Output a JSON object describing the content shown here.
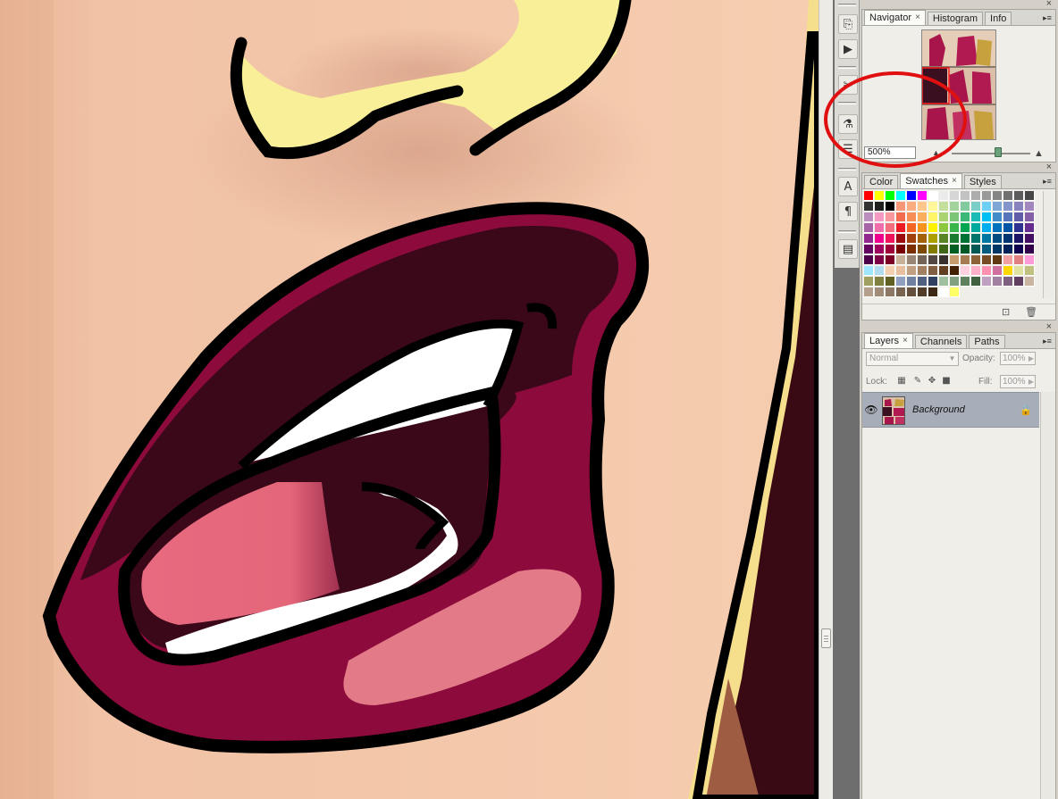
{
  "navigator": {
    "tabs": [
      {
        "label": "Navigator",
        "close": "×",
        "active": true
      },
      {
        "label": "Histogram",
        "active": false
      },
      {
        "label": "Info",
        "active": false
      }
    ],
    "zoom_value": "500%",
    "close": "×",
    "menu": "▸≡"
  },
  "swatches": {
    "tabs": [
      {
        "label": "Color",
        "active": false
      },
      {
        "label": "Swatches",
        "close": "×",
        "active": true
      },
      {
        "label": "Styles",
        "active": false
      }
    ],
    "close": "×",
    "menu": "▸≡",
    "colors": [
      "#ff0000",
      "#ffff00",
      "#00ff00",
      "#00ffff",
      "#0000ff",
      "#ff00ff",
      "#ffffff",
      "#ebebeb",
      "#d6d6d6",
      "#c2c2c2",
      "#adadad",
      "#999999",
      "#858585",
      "#707070",
      "#5c5c5c",
      "#474747",
      "#333333",
      "#1f1f1f",
      "#000000",
      "#f7977a",
      "#fbad82",
      "#fdc68a",
      "#fff79a",
      "#c4df9b",
      "#a2d39c",
      "#82ca9d",
      "#7bcdc8",
      "#6ecff6",
      "#7ea7d8",
      "#8493ca",
      "#8882be",
      "#a187be",
      "#bc8dbf",
      "#f49ac2",
      "#f6989d",
      "#f26c4f",
      "#f68e55",
      "#fbaf5c",
      "#fff467",
      "#acd372",
      "#7cc576",
      "#3bb878",
      "#1abbb4",
      "#00bff3",
      "#438cca",
      "#5574b9",
      "#605ca8",
      "#855fa8",
      "#a763a8",
      "#f06ea9",
      "#f26d7d",
      "#ed1c24",
      "#f26522",
      "#f7941d",
      "#fff200",
      "#8dc73f",
      "#39b54a",
      "#00a651",
      "#00a99d",
      "#00aeef",
      "#0072bc",
      "#0054a6",
      "#2e3192",
      "#662d91",
      "#92278f",
      "#ec008c",
      "#ed145b",
      "#9e0b0f",
      "#a0410d",
      "#a36209",
      "#aba000",
      "#598527",
      "#1a7b30",
      "#007236",
      "#00746b",
      "#0076a3",
      "#004b80",
      "#003471",
      "#1b1464",
      "#440e62",
      "#630460",
      "#9e005d",
      "#9e0039",
      "#790000",
      "#7b2e00",
      "#7d4900",
      "#827b00",
      "#406618",
      "#005e20",
      "#005826",
      "#005952",
      "#005b7f",
      "#003663",
      "#002157",
      "#0d004c",
      "#32004b",
      "#4b0049",
      "#7b0046",
      "#7a0026",
      "#c7b299",
      "#998675",
      "#736357",
      "#534741",
      "#37302d",
      "#c69c6d",
      "#a67c52",
      "#8c6239",
      "#754c24",
      "#603913",
      "#f0a0a0",
      "#e08080",
      "#ff9ad8",
      "#9fe6ff",
      "#b0dcf0",
      "#f5d0b0",
      "#e8c0a0",
      "#c0a080",
      "#a08060",
      "#806040",
      "#604020",
      "#402000",
      "#ffd0e0",
      "#ffb0c8",
      "#ff90b0",
      "#d070a0",
      "#ffd700",
      "#e0e0a0",
      "#c0c080",
      "#a0a060",
      "#808040",
      "#606020",
      "#8fa0c0",
      "#7080a0",
      "#506080",
      "#304060",
      "#a0c0a0",
      "#80a080",
      "#608060",
      "#406040",
      "#c0a0c0",
      "#a080a0",
      "#806080",
      "#604060",
      "#c8b4a0",
      "#b4a08c",
      "#a08c78",
      "#8c7864",
      "#786450",
      "#64503c",
      "#503c28",
      "#3c2814",
      "#ffffff",
      "#ffff66"
    ],
    "footer_new": "⊡",
    "footer_trash": "🗑"
  },
  "layers": {
    "tabs": [
      {
        "label": "Layers",
        "close": "×",
        "active": true
      },
      {
        "label": "Channels",
        "active": false
      },
      {
        "label": "Paths",
        "active": false
      }
    ],
    "close": "×",
    "menu": "▸≡",
    "blend_mode": "Normal",
    "opacity_label": "Opacity:",
    "opacity_value": "100%",
    "lock_label": "Lock:",
    "fill_label": "Fill:",
    "fill_value": "100%",
    "layer_name": "Background",
    "eye": "👁",
    "lock_glyph": "🔒"
  },
  "toolbar": {
    "icons": [
      "history-brush-icon",
      "actions-play-icon",
      "tool-presets-icon",
      "clone-source-icon",
      "layer-comps-icon",
      "character-icon",
      "paragraph-icon",
      "notes-icon"
    ],
    "glyphs": [
      "⎘",
      "▶",
      "✂",
      "⚗",
      "☰",
      "A",
      "¶",
      "▤"
    ]
  },
  "annotation": {
    "color": "#e01010"
  }
}
